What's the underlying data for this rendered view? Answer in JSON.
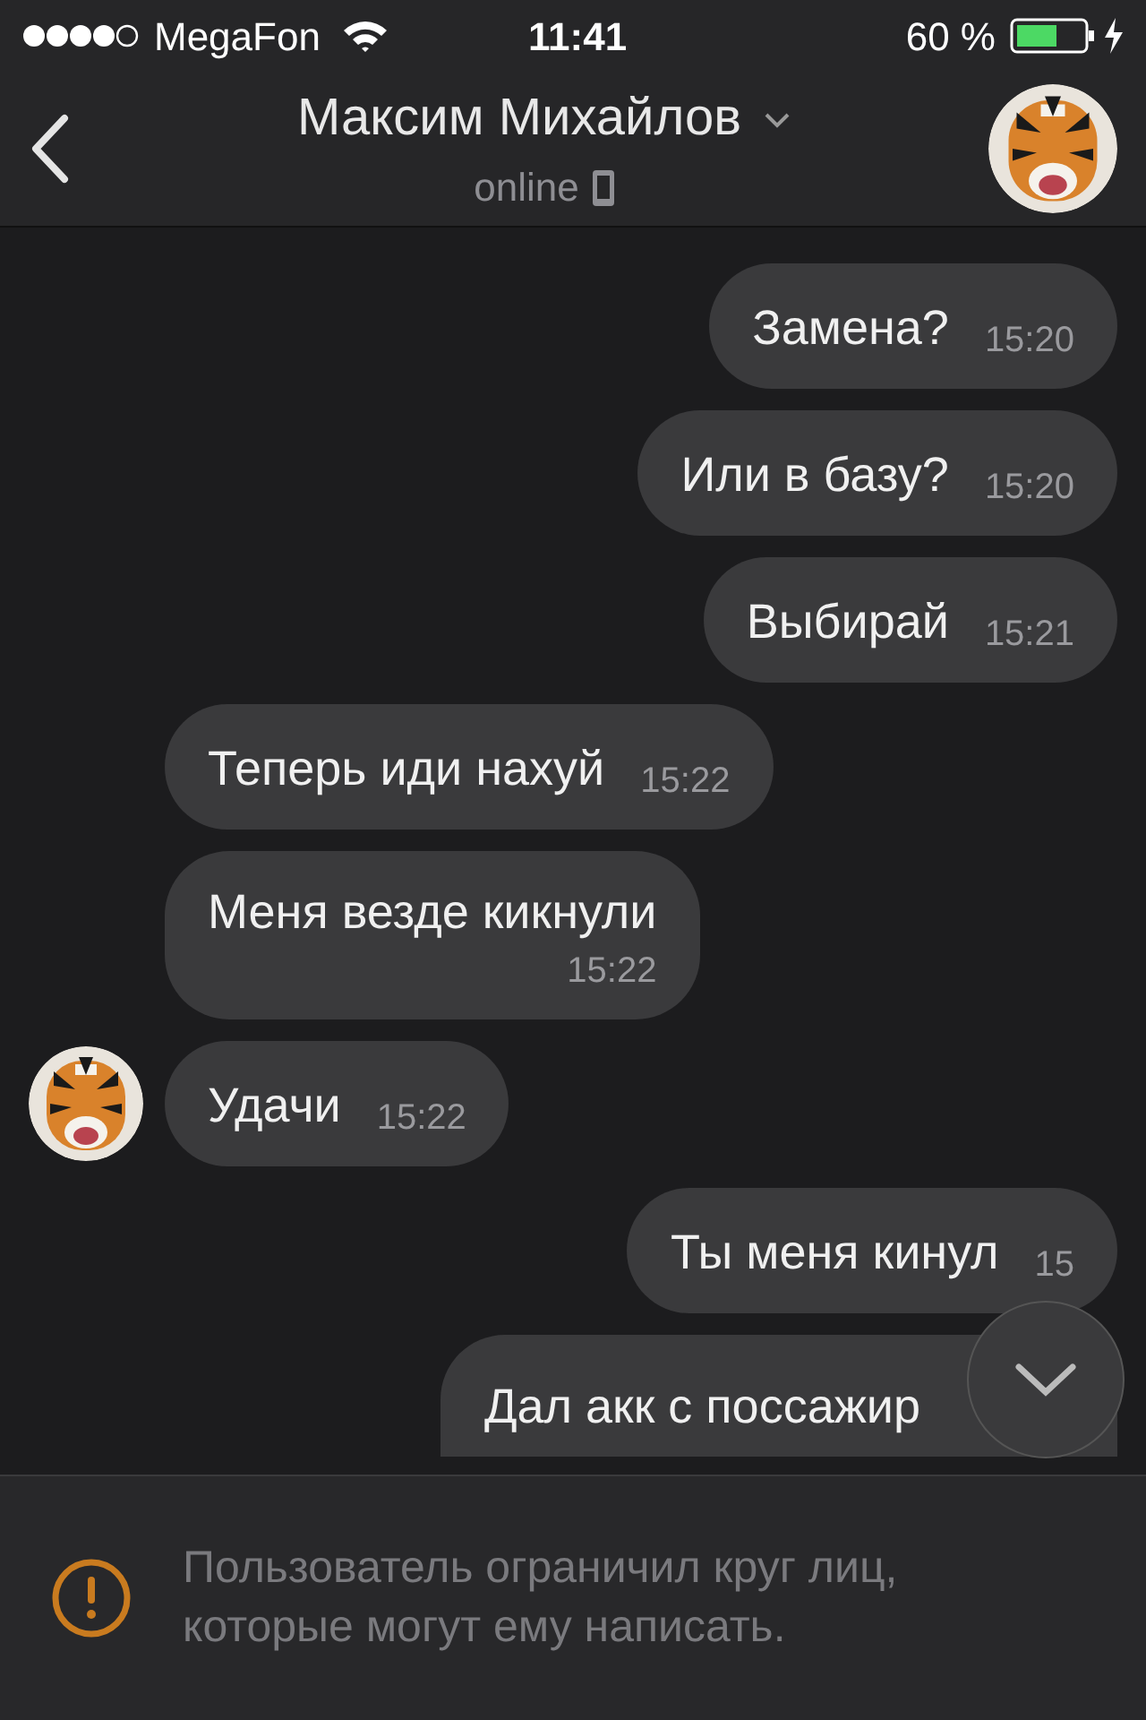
{
  "status_bar": {
    "carrier": "MegaFon",
    "time": "11:41",
    "battery": "60 %"
  },
  "header": {
    "name": "Максим Михайлов",
    "status": "online"
  },
  "messages": [
    {
      "kind": "outgoing",
      "text": "Замена?",
      "time": "15:20"
    },
    {
      "kind": "outgoing",
      "text": "Или в базу?",
      "time": "15:20"
    },
    {
      "kind": "outgoing",
      "text": "Выбирай",
      "time": "15:21"
    },
    {
      "kind": "incoming",
      "text": "Теперь иди нахуй",
      "time": "15:22",
      "avatar": false
    },
    {
      "kind": "incoming",
      "text": "Меня везде кикнули",
      "time": "15:22",
      "avatar": false,
      "wrap": true
    },
    {
      "kind": "incoming",
      "text": "Удачи",
      "time": "15:22",
      "avatar": true
    },
    {
      "kind": "outgoing",
      "text": "Ты меня кинул",
      "time": "15"
    },
    {
      "kind": "outgoing",
      "text": "Дал акк с поссажир",
      "cut": true
    }
  ],
  "notice": {
    "text": "Пользователь ограничил круг лиц, которые могут ему написать."
  }
}
